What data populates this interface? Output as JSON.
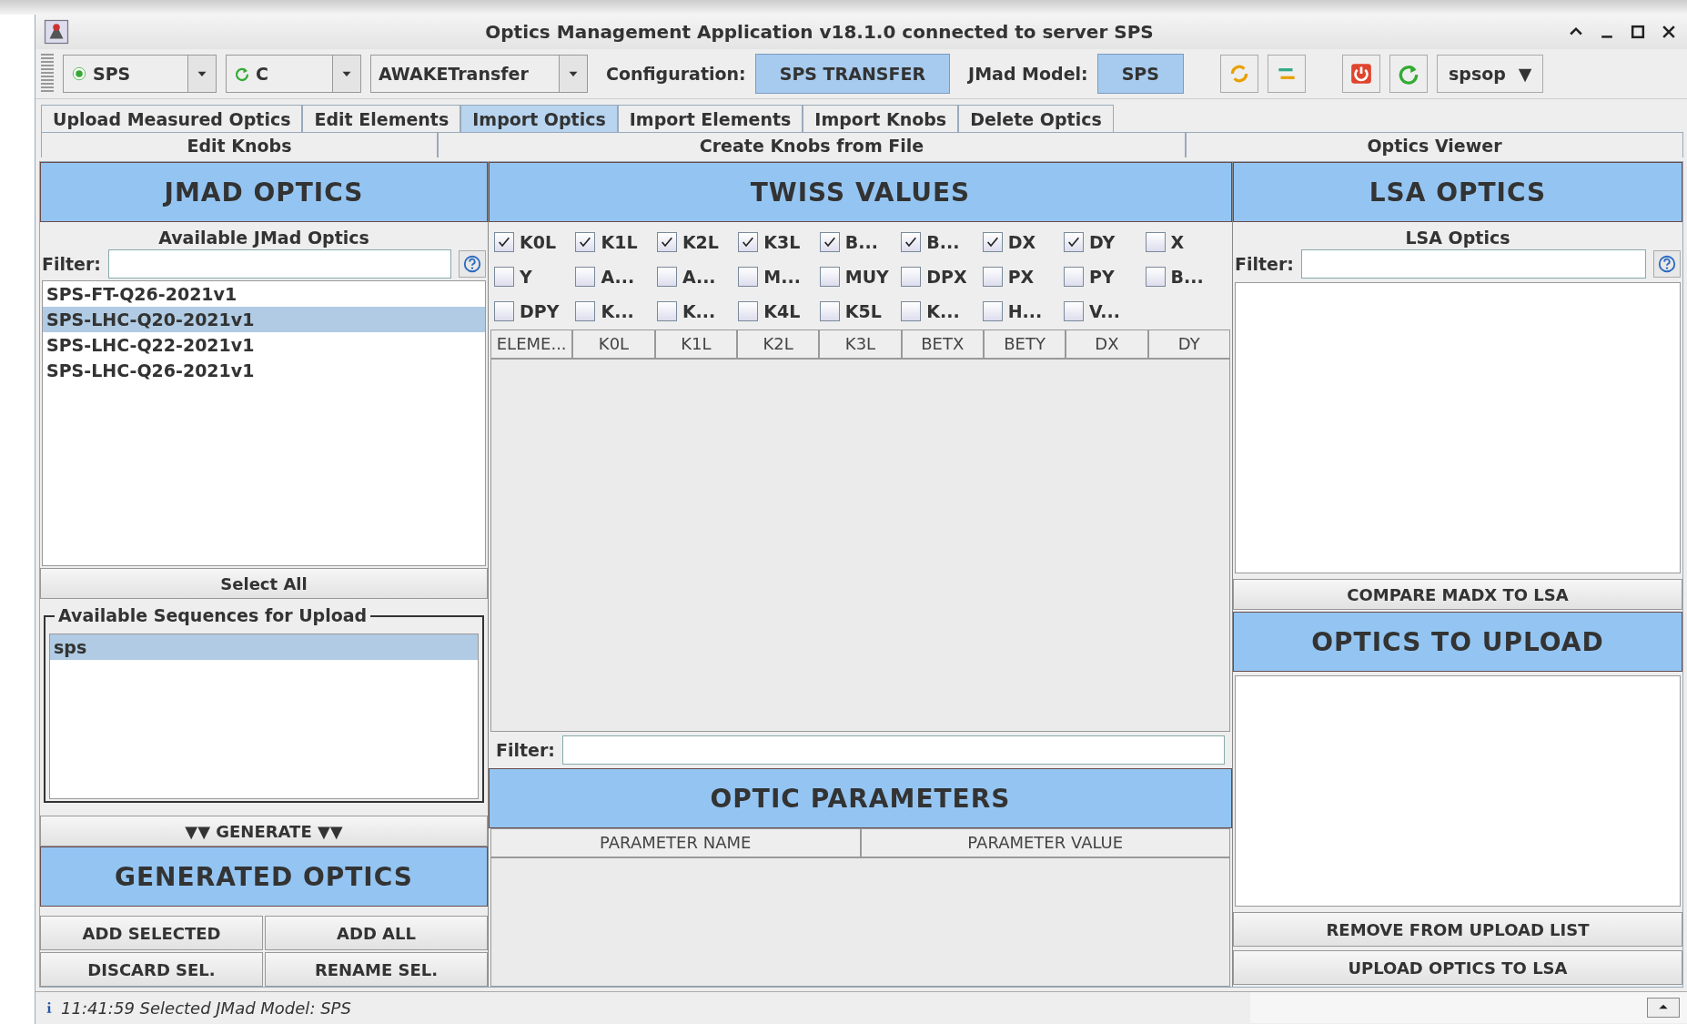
{
  "window": {
    "title": "Optics Management Application v18.1.0 connected to server SPS"
  },
  "toolbar": {
    "selectors": [
      {
        "kind": "radio",
        "value": "SPS"
      },
      {
        "kind": "refresh",
        "value": "C"
      },
      {
        "kind": "plain",
        "value": "AWAKETransfer"
      }
    ],
    "configuration": {
      "label": "Configuration:",
      "value": "SPS TRANSFER"
    },
    "model": {
      "label": "JMad Model:",
      "value": "SPS"
    },
    "user": {
      "value": "spsop",
      "arrow": "▼"
    }
  },
  "tab_rows": [
    [
      {
        "label": "Upload Measured Optics",
        "selected": false
      },
      {
        "label": "Edit Elements",
        "selected": false
      },
      {
        "label": "Import Optics",
        "selected": true
      },
      {
        "label": "Import Elements",
        "selected": false
      },
      {
        "label": "Import Knobs",
        "selected": false
      },
      {
        "label": "Delete Optics",
        "selected": false
      }
    ],
    [
      {
        "label": "Edit Knobs",
        "selected": false
      },
      {
        "label": "Create Knobs from File",
        "selected": false
      },
      {
        "label": "Optics Viewer",
        "selected": false
      }
    ]
  ],
  "jmad_panel": {
    "title": "JMAD OPTICS",
    "list_title": "Available JMad Optics",
    "filter_label": "Filter:",
    "optics": [
      {
        "name": "SPS-FT-Q26-2021v1",
        "selected": false
      },
      {
        "name": "SPS-LHC-Q20-2021v1",
        "selected": true
      },
      {
        "name": "SPS-LHC-Q22-2021v1",
        "selected": false
      },
      {
        "name": "SPS-LHC-Q26-2021v1",
        "selected": false
      }
    ],
    "select_all": "Select All",
    "sequences": {
      "title": "Available Sequences for Upload",
      "items": [
        {
          "name": "sps",
          "selected": true
        }
      ]
    },
    "generate": "▼▼ GENERATE ▼▼",
    "generated_title": "GENERATED OPTICS",
    "buttons": [
      "ADD SELECTED",
      "ADD ALL",
      "DISCARD SEL.",
      "RENAME SEL."
    ]
  },
  "twiss_panel": {
    "title": "TWISS VALUES",
    "columns_toggles": [
      {
        "label": "K0L",
        "checked": true
      },
      {
        "label": "K1L",
        "checked": true
      },
      {
        "label": "K2L",
        "checked": true
      },
      {
        "label": "K3L",
        "checked": true
      },
      {
        "label": "B...",
        "checked": true
      },
      {
        "label": "B...",
        "checked": true
      },
      {
        "label": "DX",
        "checked": true
      },
      {
        "label": "DY",
        "checked": true
      },
      {
        "label": "X",
        "checked": false
      },
      {
        "label": "Y",
        "checked": false
      },
      {
        "label": "A...",
        "checked": false
      },
      {
        "label": "A...",
        "checked": false
      },
      {
        "label": "M...",
        "checked": false
      },
      {
        "label": "MUY",
        "checked": false
      },
      {
        "label": "DPX",
        "checked": false
      },
      {
        "label": "PX",
        "checked": false
      },
      {
        "label": "PY",
        "checked": false
      },
      {
        "label": "B...",
        "checked": false
      },
      {
        "label": "DPY",
        "checked": false
      },
      {
        "label": "K...",
        "checked": false
      },
      {
        "label": "K...",
        "checked": false
      },
      {
        "label": "K4L",
        "checked": false
      },
      {
        "label": "K5L",
        "checked": false
      },
      {
        "label": "K...",
        "checked": false
      },
      {
        "label": "H...",
        "checked": false
      },
      {
        "label": "V...",
        "checked": false
      }
    ],
    "table": {
      "columns": [
        "ELEME...",
        "K0L",
        "K1L",
        "K2L",
        "K3L",
        "BETX",
        "BETY",
        "DX",
        "DY"
      ]
    },
    "filter_label": "Filter:",
    "parameters_title": "OPTIC PARAMETERS",
    "parameters_table": {
      "columns": [
        "PARAMETER NAME",
        "PARAMETER VALUE"
      ]
    }
  },
  "lsa_panel": {
    "title": "LSA OPTICS",
    "list_title": "LSA Optics",
    "filter_label": "Filter:",
    "compare": "COMPARE MADX TO LSA",
    "upload_title": "OPTICS TO UPLOAD",
    "buttons": [
      "REMOVE FROM UPLOAD LIST",
      "UPLOAD OPTICS TO LSA"
    ]
  },
  "status_bar": {
    "message": "11:41:59 Selected JMad Model: SPS"
  }
}
